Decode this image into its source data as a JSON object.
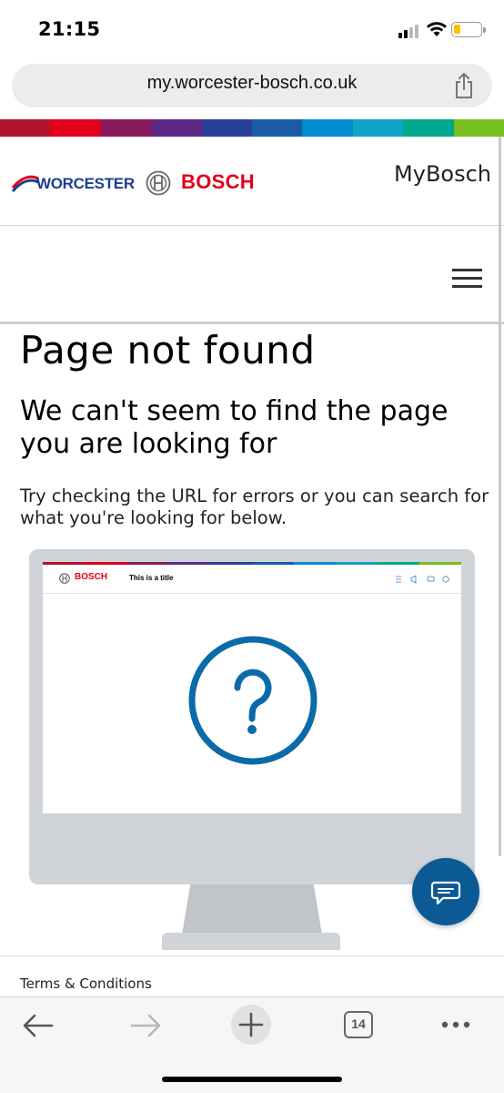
{
  "status_bar": {
    "time": "21:15",
    "battery_level": 0.25,
    "battery_color": "#f5c400",
    "signal_icon": "signal-icon",
    "wifi_icon": "wifi-icon"
  },
  "browser": {
    "url": "my.worcester-bosch.co.uk",
    "share_icon": "share-icon",
    "toolbar": {
      "back_icon": "back-arrow-icon",
      "forward_icon": "forward-arrow-icon",
      "new_tab_icon": "plus-icon",
      "tab_count": "14",
      "more_icon": "more-dots-icon"
    }
  },
  "header": {
    "worcester_logo": "WORCESTER",
    "bosch_logo": "BOSCH",
    "mybosch_label": "MyBosch",
    "menu_icon": "hamburger-menu-icon",
    "brand_colors": [
      "#b0132b",
      "#e2001a",
      "#8a1a5e",
      "#5a2a84",
      "#2a3f95",
      "#1c5aa6",
      "#008ecf",
      "#11a3c7",
      "#00a88f",
      "#78be20"
    ]
  },
  "content": {
    "title": "Page not found",
    "subtitle": "We can't seem to find the page you are looking for",
    "body": "Try checking the URL for errors or you can search for what you're looking for below.",
    "illustration": {
      "brand": "BOSCH",
      "title": "This is a title",
      "symbol": "?",
      "accent": "#0b6aa8"
    }
  },
  "chat": {
    "icon": "chat-bubble-icon",
    "color": "#0b5a96"
  },
  "footer": {
    "terms_label": "Terms & Conditions"
  }
}
